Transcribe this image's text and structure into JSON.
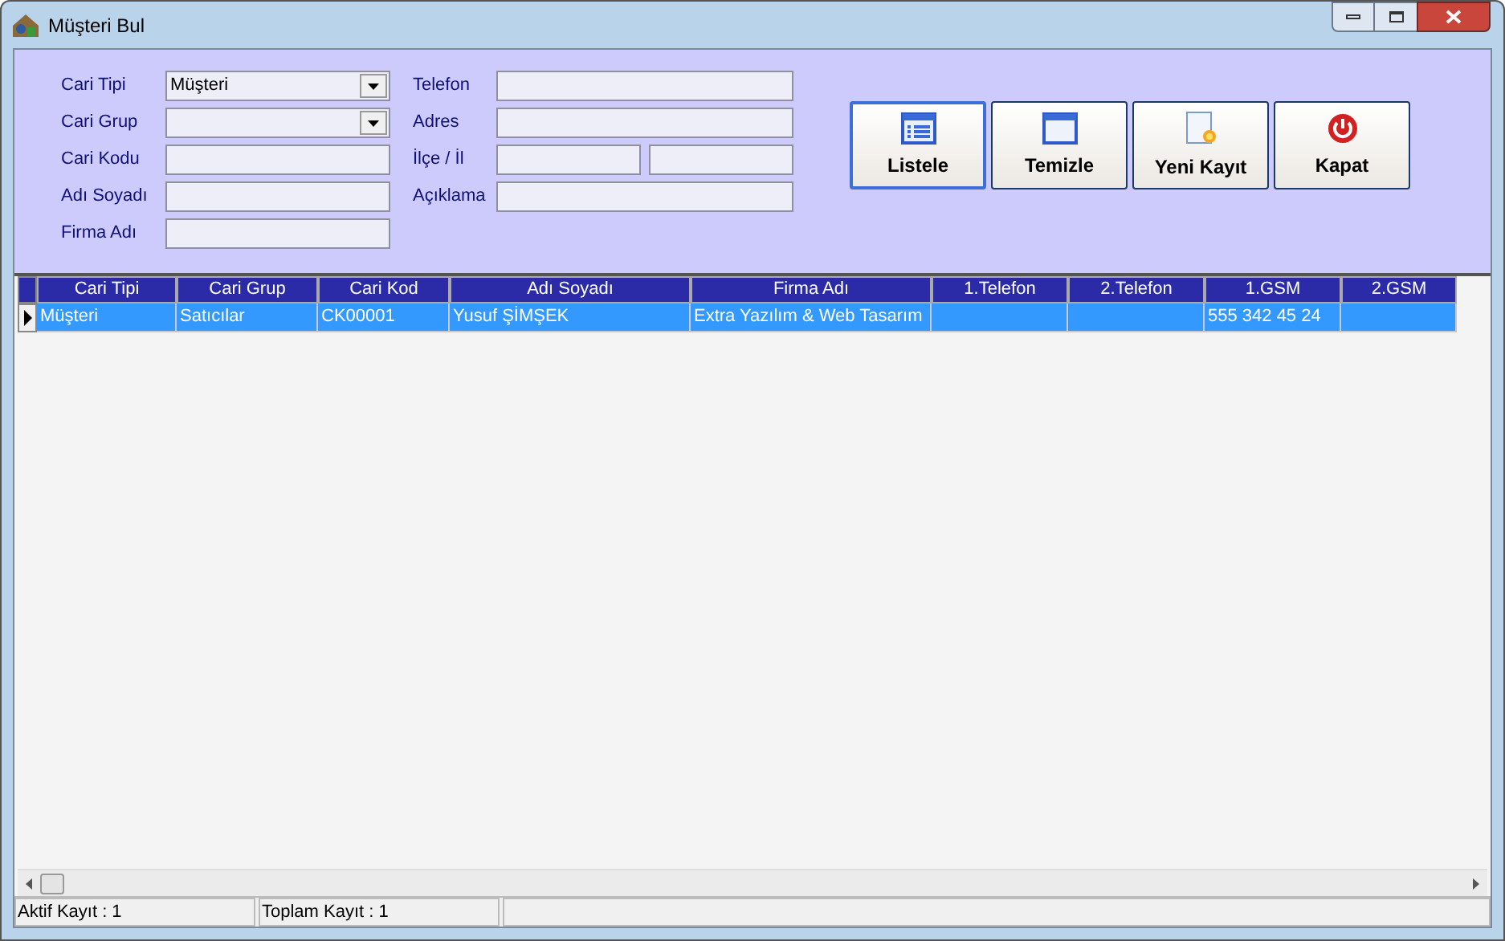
{
  "window": {
    "title": "Müşteri Bul"
  },
  "form_left": [
    {
      "label": "Cari Tipi",
      "kind": "dropdown",
      "value": "Müşteri"
    },
    {
      "label": "Cari Grup",
      "kind": "dropdown"
    },
    {
      "label": "Cari Kodu",
      "kind": "text"
    },
    {
      "label": "Adı Soyadı",
      "kind": "text"
    },
    {
      "label": "Firma Adı",
      "kind": "text"
    }
  ],
  "form_right": [
    {
      "label": "Telefon",
      "kind": "text"
    },
    {
      "label": "Adres",
      "kind": "text"
    },
    {
      "label": "İlçe / İl",
      "kind": "split"
    },
    {
      "label": "Açıklama",
      "kind": "text"
    }
  ],
  "buttons": [
    {
      "label": "Listele",
      "kind": "list",
      "selected": true
    },
    {
      "label": "Temizle",
      "kind": "window",
      "selected": false
    },
    {
      "label": "Yeni Kayıt",
      "kind": "new",
      "selected": false
    },
    {
      "label": "Kapat",
      "kind": "power",
      "selected": false
    }
  ],
  "table": {
    "columns": [
      "Cari Tipi",
      "Cari Grup",
      "Cari Kod",
      "Adı Soyadı",
      "Firma Adı",
      "1.Telefon",
      "2.Telefon",
      "1.GSM",
      "2.GSM"
    ],
    "rows": [
      {
        "selected": true,
        "cells": [
          "Müşteri",
          "Satıcılar",
          "CK00001",
          "Yusuf ŞİMŞEK",
          "Extra Yazılım & Web Tasarım",
          "",
          "",
          "555 342 45 24",
          ""
        ]
      }
    ]
  },
  "status_bar": [
    "Aktif Kayıt : 1",
    "Toplam Kayıt : 1"
  ]
}
